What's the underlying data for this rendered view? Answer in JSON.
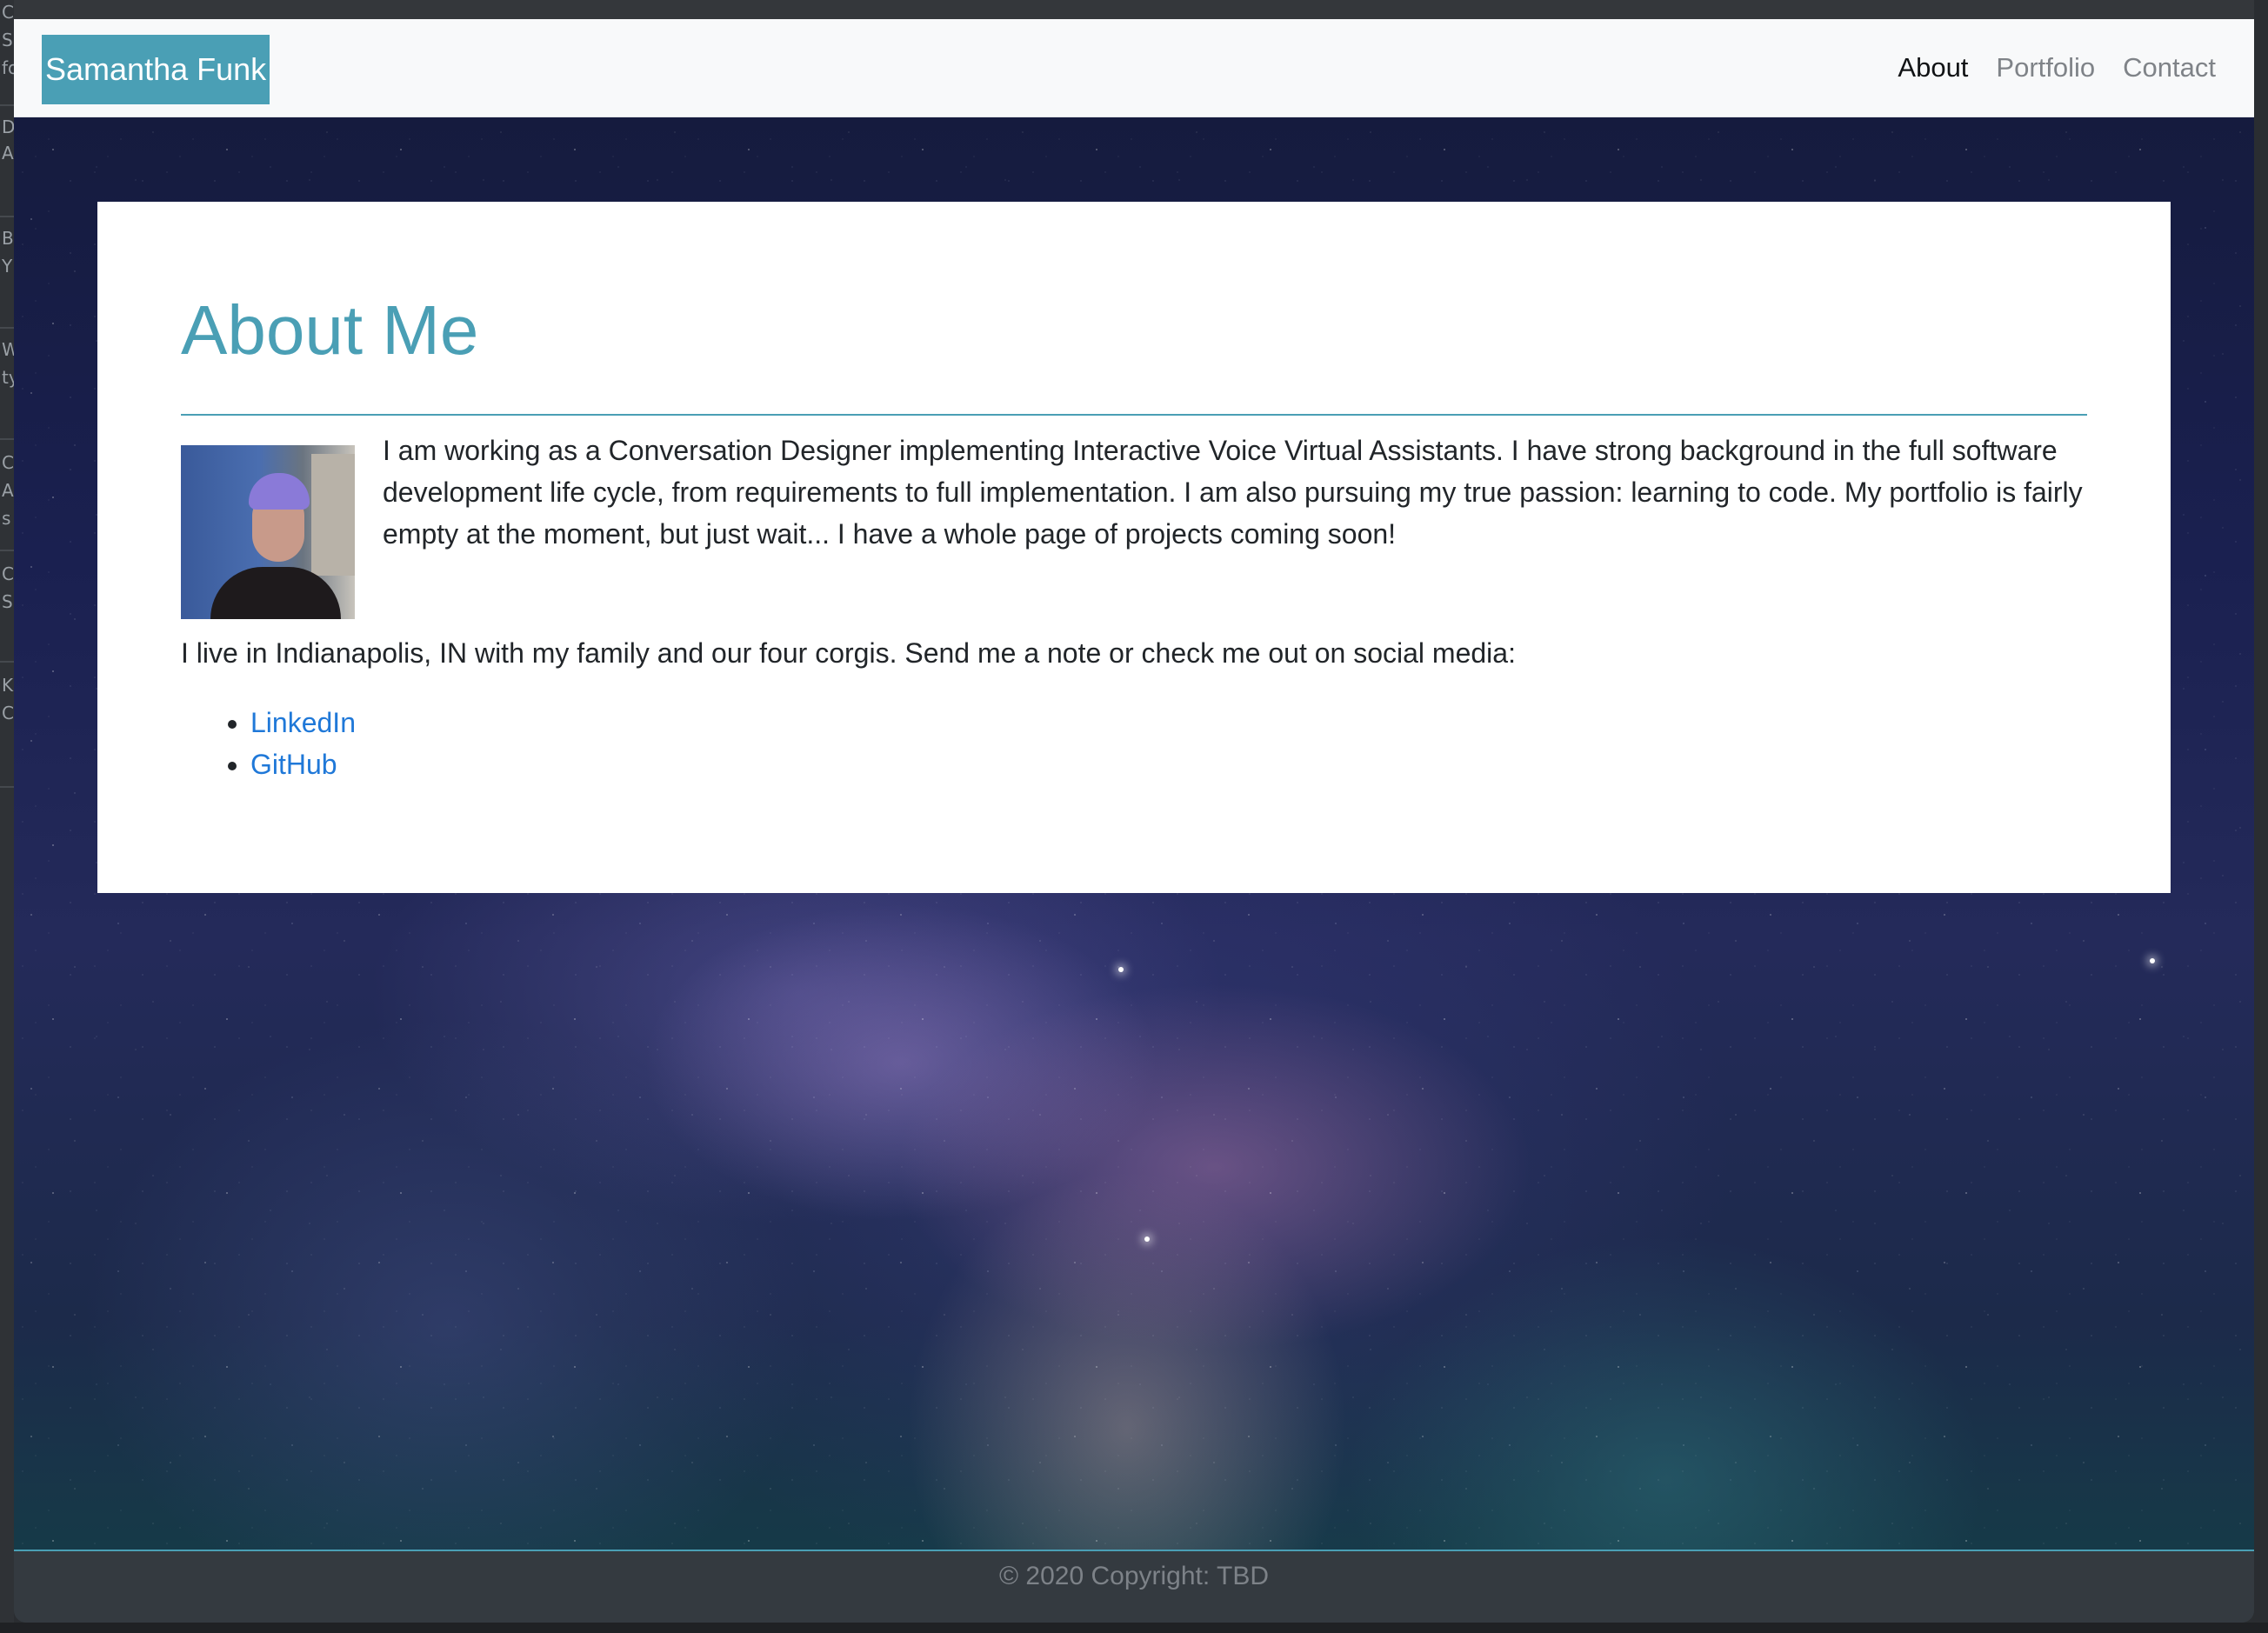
{
  "navbar": {
    "brand": "Samantha Funk",
    "links": [
      "About",
      "Portfolio",
      "Contact"
    ],
    "active": "About",
    "brand_color": "#4a9fb5"
  },
  "about": {
    "heading": "About Me",
    "bio": "I am working as a Conversation Designer implementing Interactive Voice Virtual Assistants. I have strong background in the full software development life cycle, from requirements to full implementation. I am also pursuing my true passion: learning to code. My portfolio is fairly empty at the moment, but just wait... I have a whole page of projects coming soon!",
    "location_note": "I live in Indianapolis, IN with my family and our four corgis. Send me a note or check me out on social media:",
    "social_links": [
      "LinkedIn",
      "GitHub"
    ],
    "link_color": "#1f78d8"
  },
  "footer": {
    "text": "© 2020 Copyright: TBD"
  },
  "side_window": {
    "letters": [
      "C",
      "S",
      "fo",
      "D",
      "A",
      "B",
      "Y",
      "W",
      "ty",
      "C",
      "A",
      "s",
      "C",
      "S",
      "K",
      "C"
    ]
  }
}
